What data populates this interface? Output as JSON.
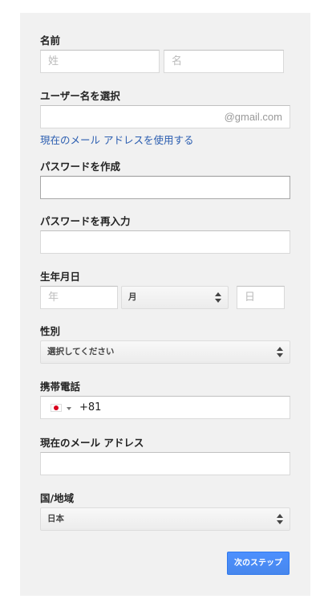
{
  "form": {
    "name": {
      "label": "名前",
      "last_placeholder": "姓",
      "first_placeholder": "名"
    },
    "username": {
      "label": "ユーザー名を選択",
      "suffix": "@gmail.com",
      "use_current_email_link": "現在のメール アドレスを使用する"
    },
    "password": {
      "label": "パスワードを作成"
    },
    "password_confirm": {
      "label": "パスワードを再入力"
    },
    "birthday": {
      "label": "生年月日",
      "year_placeholder": "年",
      "month_value": "月",
      "day_placeholder": "日"
    },
    "gender": {
      "label": "性別",
      "value": "選択してください"
    },
    "phone": {
      "label": "携帯電話",
      "country_flag": "jp-flag",
      "prefix": "+81"
    },
    "current_email": {
      "label": "現在のメール アドレス"
    },
    "country": {
      "label": "国/地域",
      "value": "日本"
    },
    "next_button": "次のステップ"
  },
  "colors": {
    "panel_bg": "#f1f1f1",
    "link": "#2a5db0",
    "primary_button": "#4d90fe",
    "flag_red": "#d9001d"
  }
}
